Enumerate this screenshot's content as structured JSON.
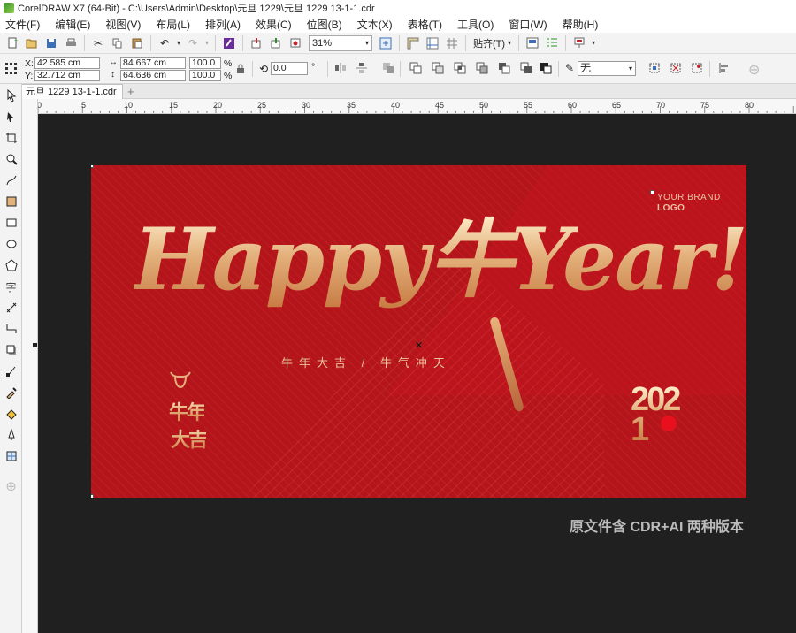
{
  "window": {
    "title": "CorelDRAW X7 (64-Bit) - C:\\Users\\Admin\\Desktop\\元旦 1229\\元旦 1229 13-1-1.cdr"
  },
  "menu": [
    "文件(F)",
    "编辑(E)",
    "视图(V)",
    "布局(L)",
    "排列(A)",
    "效果(C)",
    "位图(B)",
    "文本(X)",
    "表格(T)",
    "工具(O)",
    "窗口(W)",
    "帮助(H)"
  ],
  "toolbar": {
    "zoom": "31%",
    "snap_label": "贴齐(T)"
  },
  "properties": {
    "x_label": "X:",
    "x": "42.585 cm",
    "y_label": "Y:",
    "y": "32.712 cm",
    "width": "84.667 cm",
    "height": "64.636 cm",
    "scale_w": "100.0",
    "scale_h": "100.0",
    "percent": "%",
    "rotation": "0.0",
    "degree": "°",
    "outline": "无"
  },
  "document": {
    "tab": "元旦 1229 13-1-1.cdr",
    "add_tab": "+"
  },
  "ruler": {
    "marks": [
      "0",
      "5",
      "10",
      "15",
      "20",
      "25",
      "30",
      "35",
      "40",
      "45",
      "50",
      "55",
      "60",
      "65",
      "70",
      "75",
      "80"
    ]
  },
  "artwork": {
    "headline": "Happy牛Year!",
    "subline": "牛年大吉 / 牛气冲天",
    "brand_line1": "YOUR BRAND",
    "brand_line2": "LOGO",
    "badge_line1": "牛年",
    "badge_line2": "大吉",
    "year": "2021"
  },
  "watermark": "原文件含 CDR+AI 两种版本",
  "icons": [
    "new-icon",
    "open-icon",
    "save-icon",
    "print-icon",
    "cut-icon",
    "copy-icon",
    "paste-icon",
    "undo-icon",
    "redo-icon",
    "import-icon",
    "export-icon",
    "publish-icon",
    "zoom-fit-icon",
    "rulers-icon",
    "guides-icon",
    "snap-icon",
    "options-icon",
    "launcher-icon"
  ],
  "colors": {
    "background_red": "#b3151b",
    "canvas": "#202020",
    "gold": "#e3b17c"
  }
}
